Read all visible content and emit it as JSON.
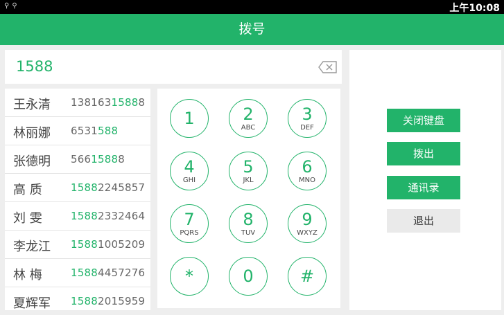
{
  "status_bar": {
    "time": "上午10:08",
    "icons": [
      "usb-icon",
      "usb-debug-icon"
    ]
  },
  "title": "拨号",
  "input": {
    "number": "1588"
  },
  "contacts": [
    {
      "name": "王永清",
      "phone_prefix": "138163",
      "phone_match": "1588",
      "phone_suffix": "8"
    },
    {
      "name": "林丽娜",
      "phone_prefix": "6531",
      "phone_match": "588",
      "phone_suffix": ""
    },
    {
      "name": "张德明",
      "phone_prefix": "566",
      "phone_match": "1588",
      "phone_suffix": "8"
    },
    {
      "name": "高 质",
      "phone_prefix": "",
      "phone_match": "1588",
      "phone_suffix": "2245857"
    },
    {
      "name": "刘 雯",
      "phone_prefix": "",
      "phone_match": "1588",
      "phone_suffix": "2332464"
    },
    {
      "name": "李龙江",
      "phone_prefix": "",
      "phone_match": "1588",
      "phone_suffix": "1005209"
    },
    {
      "name": "林 梅",
      "phone_prefix": "",
      "phone_match": "1588",
      "phone_suffix": "4457276"
    },
    {
      "name": "夏辉军",
      "phone_prefix": "",
      "phone_match": "1588",
      "phone_suffix": "2015959"
    }
  ],
  "keypad": [
    {
      "digit": "1",
      "letters": ""
    },
    {
      "digit": "2",
      "letters": "ABC"
    },
    {
      "digit": "3",
      "letters": "DEF"
    },
    {
      "digit": "4",
      "letters": "GHI"
    },
    {
      "digit": "5",
      "letters": "JKL"
    },
    {
      "digit": "6",
      "letters": "MNO"
    },
    {
      "digit": "7",
      "letters": "PQRS"
    },
    {
      "digit": "8",
      "letters": "TUV"
    },
    {
      "digit": "9",
      "letters": "WXYZ"
    },
    {
      "digit": "*",
      "letters": ""
    },
    {
      "digit": "0",
      "letters": ""
    },
    {
      "digit": "#",
      "letters": ""
    }
  ],
  "buttons": {
    "close_keyboard": "关闭键盘",
    "dial": "拨出",
    "contacts": "通讯录",
    "exit": "退出"
  },
  "colors": {
    "accent": "#22b36a",
    "status_bar": "#000000",
    "background": "#eeeeee"
  }
}
